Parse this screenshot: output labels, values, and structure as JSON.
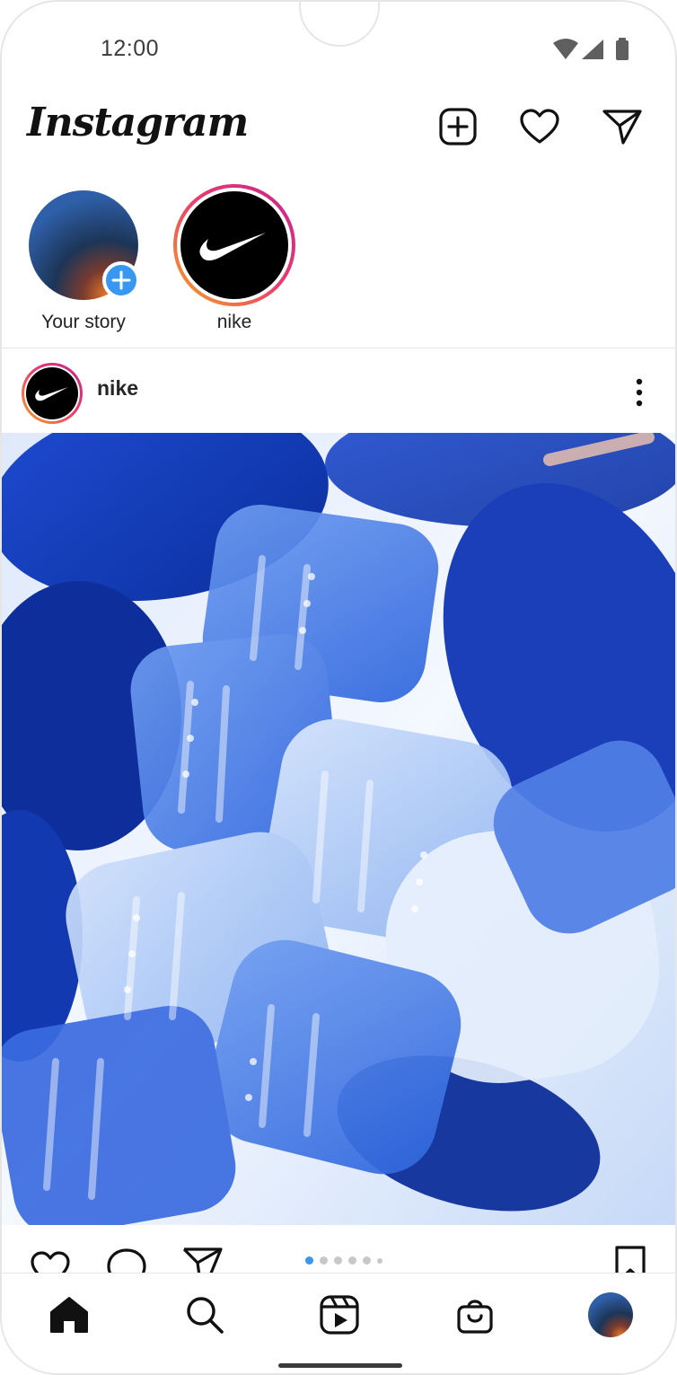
{
  "status_bar": {
    "time": "12:00",
    "icons": [
      "wifi-icon",
      "signal-icon",
      "battery-icon"
    ]
  },
  "header": {
    "logo": "Instagram",
    "icons": [
      "new-post-icon",
      "heart-icon",
      "direct-message-icon"
    ]
  },
  "stories": [
    {
      "label": "Your story",
      "type": "own",
      "badge": "+"
    },
    {
      "label": "nike",
      "type": "brand"
    }
  ],
  "post": {
    "username": "nike",
    "carousel": {
      "count": 6,
      "active_index": 0
    },
    "actions": [
      "like-icon",
      "comment-icon",
      "share-icon",
      "save-icon"
    ]
  },
  "bottom_nav": [
    "home-icon",
    "search-icon",
    "reels-icon",
    "shop-icon",
    "profile-avatar"
  ],
  "colors": {
    "accent_blue": "#3897f0",
    "story_ring_start": "#f5a623",
    "story_ring_end": "#d6249f",
    "text": "#262626"
  }
}
